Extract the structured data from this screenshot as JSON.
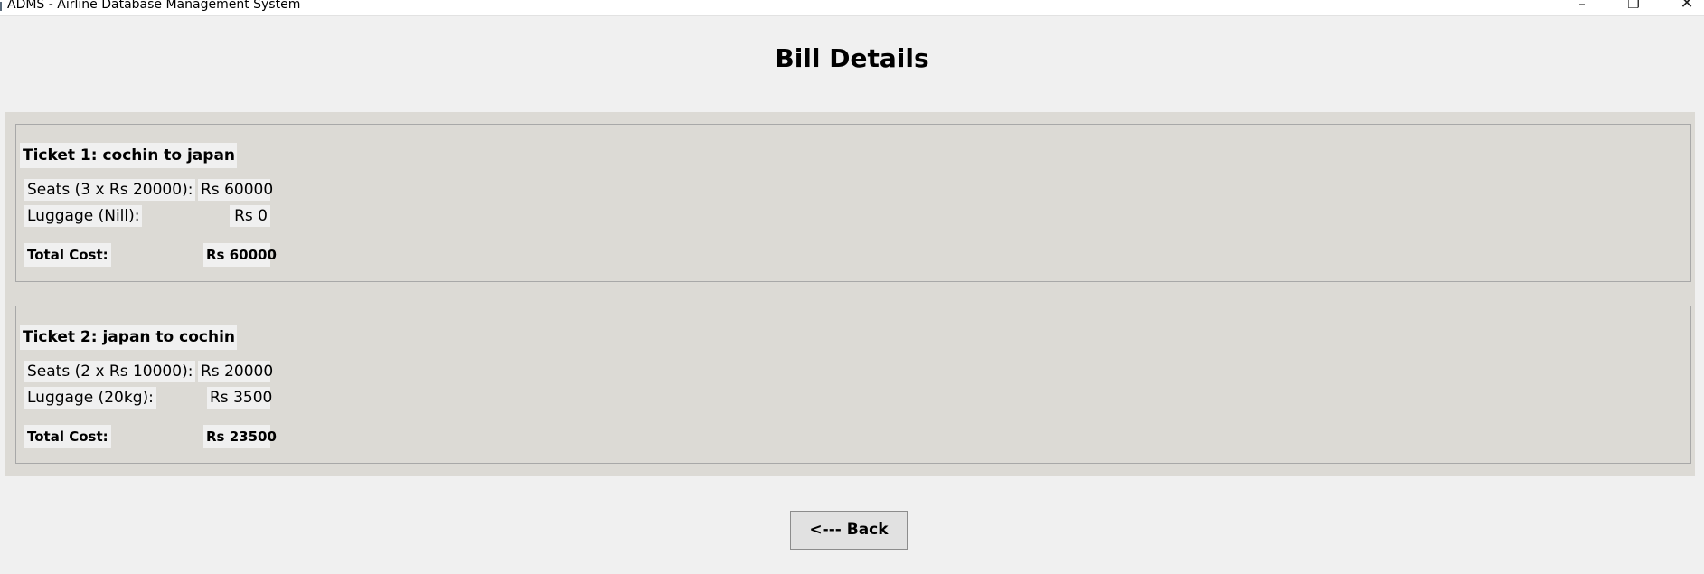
{
  "window": {
    "title": "ADMS - Airline Database Management System",
    "controls": {
      "minimize": "–",
      "maximize": "❐",
      "close": "✕"
    }
  },
  "page": {
    "title": "Bill Details"
  },
  "tickets": [
    {
      "heading": "Ticket 1: cochin to japan",
      "seats_label": "Seats (3 x Rs 20000):",
      "seats_value": "Rs 60000",
      "luggage_label": "Luggage (Nill):",
      "luggage_value": "Rs 0",
      "total_label": "Total Cost:",
      "total_value": "Rs 60000"
    },
    {
      "heading": "Ticket 2: japan to cochin",
      "seats_label": "Seats (2 x Rs 10000):",
      "seats_value": "Rs 20000",
      "luggage_label": "Luggage (20kg):",
      "luggage_value": "Rs 3500",
      "total_label": "Total Cost:",
      "total_value": "Rs 23500"
    }
  ],
  "actions": {
    "back_label": "<--- Back"
  },
  "colors": {
    "window_bg": "#f0f0f0",
    "frame_bg": "#dcdad5",
    "label_bg": "#f0f0f0",
    "button_bg": "#e1e1e1"
  }
}
